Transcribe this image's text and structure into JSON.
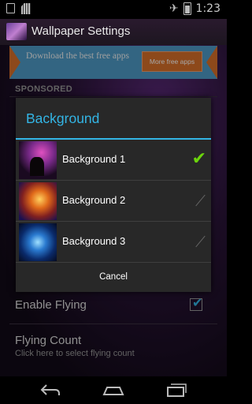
{
  "status_bar": {
    "time": "1:23",
    "icons": [
      "picture-icon",
      "sd-card-icon",
      "airplane-icon",
      "battery-icon"
    ]
  },
  "app_bar": {
    "title": "Wallpaper Settings",
    "icon": "app-icon"
  },
  "ad": {
    "text": "Download the best free apps",
    "button_label": "More free apps",
    "colors": {
      "background": "#4f9cc8",
      "accent": "#d9702a"
    }
  },
  "sponsored_label": "SPONSORED",
  "settings": {
    "enable_flying": {
      "title": "Enable Flying",
      "checked": true
    },
    "flying_count": {
      "title": "Flying Count",
      "subtitle": "Click here to select flying count"
    }
  },
  "dialog": {
    "title": "Background",
    "options": [
      {
        "label": "Background 1",
        "selected": true
      },
      {
        "label": "Background 2",
        "selected": false
      },
      {
        "label": "Background 3",
        "selected": false
      }
    ],
    "cancel_label": "Cancel",
    "colors": {
      "title": "#33b5e5",
      "check": "#6bd40c"
    }
  },
  "nav_bar": {
    "buttons": [
      "back-icon",
      "home-icon",
      "recent-apps-icon"
    ]
  }
}
